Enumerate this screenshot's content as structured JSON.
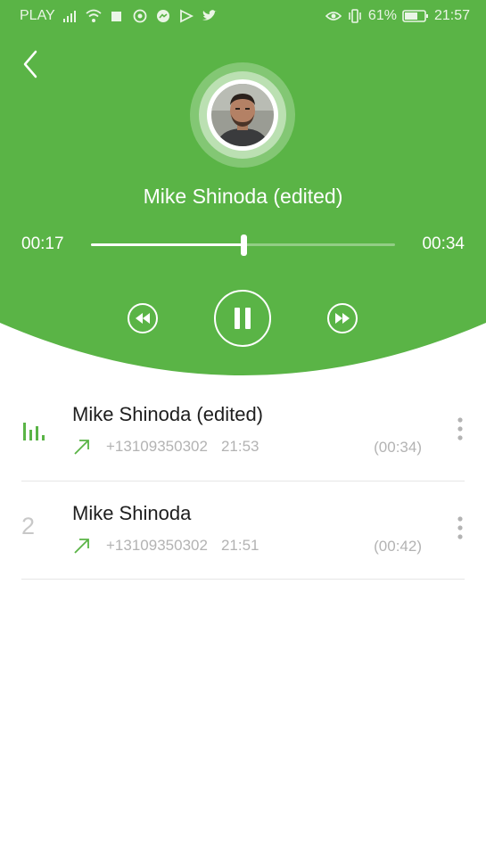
{
  "status_bar": {
    "carrier": "PLAY",
    "battery": "61%",
    "time": "21:57"
  },
  "player": {
    "title": "Mike Shinoda (edited)",
    "elapsed": "00:17",
    "total": "00:34",
    "progress": 0.5,
    "state": "playing"
  },
  "recordings": [
    {
      "playing": true,
      "index": "1",
      "name": "Mike Shinoda (edited)",
      "number": "+13109350302",
      "time": "21:53",
      "duration": "(00:34)"
    },
    {
      "playing": false,
      "index": "2",
      "name": "Mike Shinoda",
      "number": "+13109350302",
      "time": "21:51",
      "duration": "(00:42)"
    }
  ],
  "colors": {
    "accent": "#5ab446",
    "text_secondary": "#b3b3b3"
  }
}
